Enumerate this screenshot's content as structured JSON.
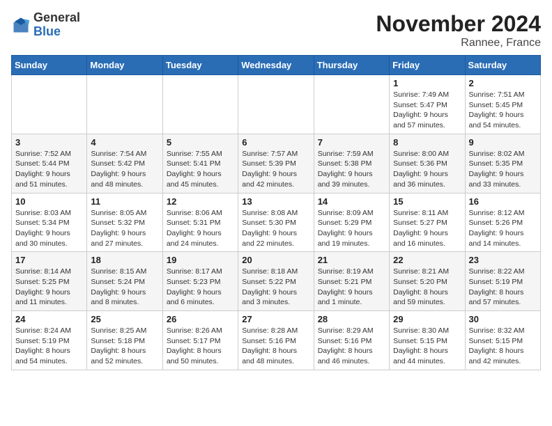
{
  "logo": {
    "general": "General",
    "blue": "Blue"
  },
  "header": {
    "month": "November 2024",
    "location": "Rannee, France"
  },
  "weekdays": [
    "Sunday",
    "Monday",
    "Tuesday",
    "Wednesday",
    "Thursday",
    "Friday",
    "Saturday"
  ],
  "weeks": [
    [
      {
        "day": "",
        "detail": ""
      },
      {
        "day": "",
        "detail": ""
      },
      {
        "day": "",
        "detail": ""
      },
      {
        "day": "",
        "detail": ""
      },
      {
        "day": "",
        "detail": ""
      },
      {
        "day": "1",
        "detail": "Sunrise: 7:49 AM\nSunset: 5:47 PM\nDaylight: 9 hours and 57 minutes."
      },
      {
        "day": "2",
        "detail": "Sunrise: 7:51 AM\nSunset: 5:45 PM\nDaylight: 9 hours and 54 minutes."
      }
    ],
    [
      {
        "day": "3",
        "detail": "Sunrise: 7:52 AM\nSunset: 5:44 PM\nDaylight: 9 hours and 51 minutes."
      },
      {
        "day": "4",
        "detail": "Sunrise: 7:54 AM\nSunset: 5:42 PM\nDaylight: 9 hours and 48 minutes."
      },
      {
        "day": "5",
        "detail": "Sunrise: 7:55 AM\nSunset: 5:41 PM\nDaylight: 9 hours and 45 minutes."
      },
      {
        "day": "6",
        "detail": "Sunrise: 7:57 AM\nSunset: 5:39 PM\nDaylight: 9 hours and 42 minutes."
      },
      {
        "day": "7",
        "detail": "Sunrise: 7:59 AM\nSunset: 5:38 PM\nDaylight: 9 hours and 39 minutes."
      },
      {
        "day": "8",
        "detail": "Sunrise: 8:00 AM\nSunset: 5:36 PM\nDaylight: 9 hours and 36 minutes."
      },
      {
        "day": "9",
        "detail": "Sunrise: 8:02 AM\nSunset: 5:35 PM\nDaylight: 9 hours and 33 minutes."
      }
    ],
    [
      {
        "day": "10",
        "detail": "Sunrise: 8:03 AM\nSunset: 5:34 PM\nDaylight: 9 hours and 30 minutes."
      },
      {
        "day": "11",
        "detail": "Sunrise: 8:05 AM\nSunset: 5:32 PM\nDaylight: 9 hours and 27 minutes."
      },
      {
        "day": "12",
        "detail": "Sunrise: 8:06 AM\nSunset: 5:31 PM\nDaylight: 9 hours and 24 minutes."
      },
      {
        "day": "13",
        "detail": "Sunrise: 8:08 AM\nSunset: 5:30 PM\nDaylight: 9 hours and 22 minutes."
      },
      {
        "day": "14",
        "detail": "Sunrise: 8:09 AM\nSunset: 5:29 PM\nDaylight: 9 hours and 19 minutes."
      },
      {
        "day": "15",
        "detail": "Sunrise: 8:11 AM\nSunset: 5:27 PM\nDaylight: 9 hours and 16 minutes."
      },
      {
        "day": "16",
        "detail": "Sunrise: 8:12 AM\nSunset: 5:26 PM\nDaylight: 9 hours and 14 minutes."
      }
    ],
    [
      {
        "day": "17",
        "detail": "Sunrise: 8:14 AM\nSunset: 5:25 PM\nDaylight: 9 hours and 11 minutes."
      },
      {
        "day": "18",
        "detail": "Sunrise: 8:15 AM\nSunset: 5:24 PM\nDaylight: 9 hours and 8 minutes."
      },
      {
        "day": "19",
        "detail": "Sunrise: 8:17 AM\nSunset: 5:23 PM\nDaylight: 9 hours and 6 minutes."
      },
      {
        "day": "20",
        "detail": "Sunrise: 8:18 AM\nSunset: 5:22 PM\nDaylight: 9 hours and 3 minutes."
      },
      {
        "day": "21",
        "detail": "Sunrise: 8:19 AM\nSunset: 5:21 PM\nDaylight: 9 hours and 1 minute."
      },
      {
        "day": "22",
        "detail": "Sunrise: 8:21 AM\nSunset: 5:20 PM\nDaylight: 8 hours and 59 minutes."
      },
      {
        "day": "23",
        "detail": "Sunrise: 8:22 AM\nSunset: 5:19 PM\nDaylight: 8 hours and 57 minutes."
      }
    ],
    [
      {
        "day": "24",
        "detail": "Sunrise: 8:24 AM\nSunset: 5:19 PM\nDaylight: 8 hours and 54 minutes."
      },
      {
        "day": "25",
        "detail": "Sunrise: 8:25 AM\nSunset: 5:18 PM\nDaylight: 8 hours and 52 minutes."
      },
      {
        "day": "26",
        "detail": "Sunrise: 8:26 AM\nSunset: 5:17 PM\nDaylight: 8 hours and 50 minutes."
      },
      {
        "day": "27",
        "detail": "Sunrise: 8:28 AM\nSunset: 5:16 PM\nDaylight: 8 hours and 48 minutes."
      },
      {
        "day": "28",
        "detail": "Sunrise: 8:29 AM\nSunset: 5:16 PM\nDaylight: 8 hours and 46 minutes."
      },
      {
        "day": "29",
        "detail": "Sunrise: 8:30 AM\nSunset: 5:15 PM\nDaylight: 8 hours and 44 minutes."
      },
      {
        "day": "30",
        "detail": "Sunrise: 8:32 AM\nSunset: 5:15 PM\nDaylight: 8 hours and 42 minutes."
      }
    ]
  ]
}
